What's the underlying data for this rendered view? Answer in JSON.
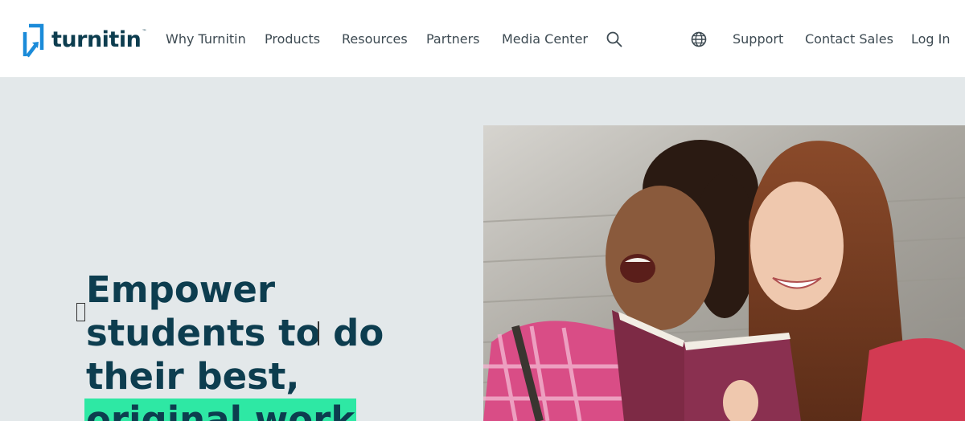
{
  "brand": {
    "name": "turnitin",
    "tm": "™"
  },
  "nav": {
    "primary": [
      "Why Turnitin",
      "Products",
      "Resources",
      "Partners",
      "Media Center"
    ],
    "secondary": [
      "Support",
      "Contact Sales",
      "Log In"
    ]
  },
  "icons": {
    "search": "search-icon",
    "language": "globe-icon",
    "logo": "turnitin-logo-mark"
  },
  "hero": {
    "headline_lines": [
      "Empower",
      "students to do",
      "their best,"
    ],
    "headline_highlight": "original work"
  },
  "colors": {
    "brand_dark": "#0d3d4f",
    "brand_blue": "#1b8bd9",
    "highlight": "#2ee8a4",
    "hero_bg": "#e3e8ea",
    "nav_text": "#3d4a52"
  }
}
